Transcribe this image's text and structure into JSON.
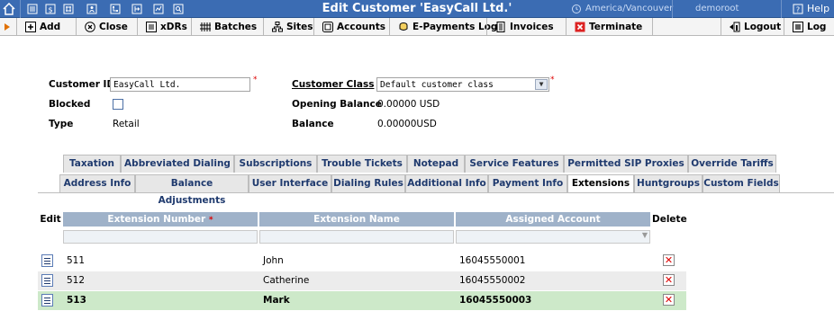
{
  "title_bar": {
    "title": "Edit Customer 'EasyCall Ltd.'",
    "timezone": "America/Vancouver",
    "user": "demoroot",
    "help": "Help",
    "timezone_icon": "clock-icon"
  },
  "toolbar": {
    "add": "Add",
    "close": "Close",
    "xdrs": "xDRs",
    "batches": "Batches",
    "sites": "Sites",
    "accounts": "Accounts",
    "epayments_log": "E-Payments Log",
    "invoices": "Invoices",
    "terminate": "Terminate",
    "logout": "Logout",
    "log": "Log"
  },
  "form": {
    "customer_id_label": "Customer ID",
    "customer_id_value": "EasyCall Ltd.",
    "blocked_label": "Blocked",
    "type_label": "Type",
    "type_value": "Retail",
    "customer_class_label": "Customer Class",
    "customer_class_value": "Default customer class",
    "opening_balance_label": "Opening Balance",
    "opening_balance_value": "0.00000 USD",
    "balance_label": "Balance",
    "balance_value": "0.00000USD",
    "required_mark": "*"
  },
  "tabs_row1": [
    "Taxation",
    "Abbreviated Dialing",
    "Subscriptions",
    "Trouble Tickets",
    "Notepad",
    "Service Features",
    "Permitted SIP Proxies",
    "Override Tariffs"
  ],
  "tabs_row2": [
    "Address Info",
    "Balance Adjustments",
    "User Interface",
    "Dialing Rules",
    "Additional Info",
    "Payment Info",
    "Extensions",
    "Huntgroups",
    "Custom Fields"
  ],
  "active_tab": "Extensions",
  "grid": {
    "headers": {
      "edit": "Edit",
      "extension_number": "Extension Number",
      "extension_name": "Extension Name",
      "assigned_account": "Assigned Account",
      "delete": "Delete"
    },
    "rows": [
      {
        "number": "511",
        "name": "John",
        "account": "16045550001"
      },
      {
        "number": "512",
        "name": "Catherine",
        "account": "16045550002"
      },
      {
        "number": "513",
        "name": "Mark",
        "account": "16045550003"
      }
    ]
  },
  "colors": {
    "title_bar": "#3b6cb3",
    "grid_header": "#9fb2c9",
    "highlight_row": "#cde9c9",
    "alt_row": "#ececec"
  }
}
